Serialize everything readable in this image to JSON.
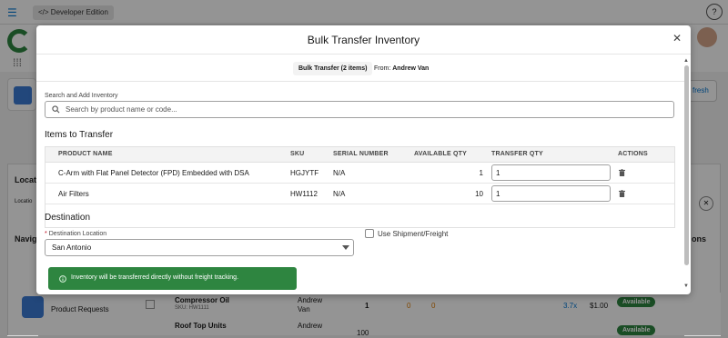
{
  "background": {
    "edition_label": "Developer Edition",
    "refresh_label": "fresh",
    "side_labels": {
      "location": "Locati",
      "location_small": "Locatio",
      "navigation": "Navig",
      "actions": "ons"
    },
    "rows": [
      {
        "name": "Compressor Oil",
        "sku": "SKU: HW1111",
        "nav_label": "Product Requests",
        "owner_line1": "Andrew",
        "owner_line2": "Van",
        "qty": "1",
        "a": "0",
        "b": "0",
        "fx": "3.7x",
        "price": "$1.00",
        "status": "Available"
      },
      {
        "name": "Roof Top Units",
        "owner_line1": "Andrew",
        "qty": "100",
        "status": "Available"
      }
    ],
    "colors": {
      "brand": "#0176d3",
      "success": "#2e8540"
    }
  },
  "modal": {
    "title": "Bulk Transfer Inventory",
    "close_icon": "close-icon",
    "transfer_count_label": "Bulk Transfer (2 items)",
    "from_label": "From:",
    "from_name": "Andrew Van",
    "search": {
      "label": "Search and Add Inventory",
      "placeholder": "Search by product name or code...",
      "value": ""
    },
    "items_title": "Items to Transfer",
    "table": {
      "headers": {
        "product_name": "PRODUCT NAME",
        "sku": "SKU",
        "serial_number": "SERIAL NUMBER",
        "available_qty": "AVAILABLE QTY",
        "transfer_qty": "TRANSFER QTY",
        "actions": "ACTIONS"
      },
      "rows": [
        {
          "product_name": "C-Arm with Flat Panel Detector (FPD) Embedded with DSA",
          "sku": "HGJYTF",
          "serial_number": "N/A",
          "available_qty": "1",
          "transfer_qty": "1"
        },
        {
          "product_name": "Air Filters",
          "sku": "HW1112",
          "serial_number": "N/A",
          "available_qty": "10",
          "transfer_qty": "1"
        }
      ]
    },
    "destination": {
      "title": "Destination",
      "required_mark": "*",
      "field_label": "Destination Location",
      "value": "San Antonio"
    },
    "freight": {
      "label": "Use Shipment/Freight",
      "checked": false
    },
    "info_banner": "Inventory will be transferred directly without freight tracking."
  }
}
